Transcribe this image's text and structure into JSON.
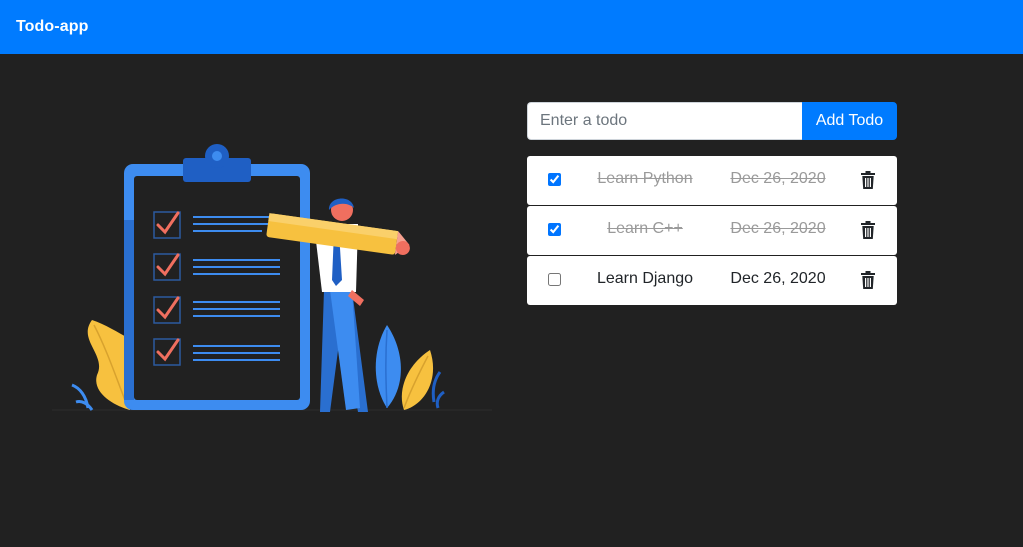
{
  "navbar": {
    "brand": "Todo-app"
  },
  "add_form": {
    "placeholder": "Enter a todo",
    "value": "",
    "button_label": "Add Todo"
  },
  "todos": [
    {
      "text": "Learn Python",
      "date": "Dec 26, 2020",
      "completed": true,
      "icon": "trash-icon"
    },
    {
      "text": "Learn C++",
      "date": "Dec 26, 2020",
      "completed": true,
      "icon": "trash-icon"
    },
    {
      "text": "Learn Django",
      "date": "Dec 26, 2020",
      "completed": false,
      "icon": "trash-icon"
    }
  ],
  "colors": {
    "primary": "#007bff",
    "background": "#212121",
    "completed_text": "#9a9a9a",
    "illustration_blue": "#3d8cf0",
    "illustration_yellow": "#f7c13f",
    "check_red": "#f06f5f"
  }
}
